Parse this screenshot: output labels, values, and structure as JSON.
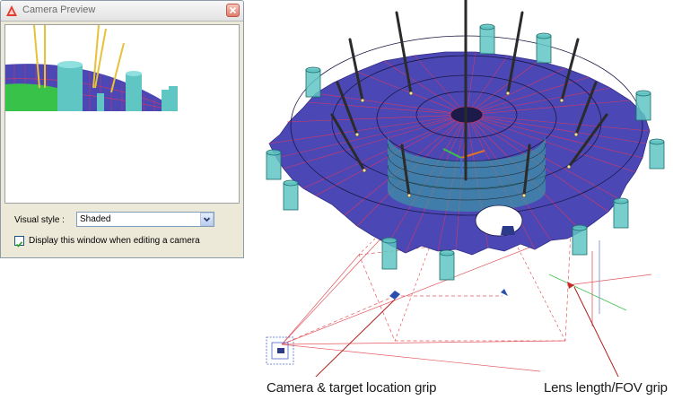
{
  "dialog": {
    "title": "Camera Preview",
    "visual_style_label": "Visual style :",
    "visual_style_value": "Shaded",
    "display_checkbox_label": "Display this window when editing a camera",
    "display_checkbox_checked": true
  },
  "callouts": {
    "camera_target_grip": "Camera & target location grip",
    "lens_fov_grip": "Lens length/FOV grip"
  },
  "colors": {
    "roof_fill": "#4b47b5",
    "roof_lines": "#e0375e",
    "mast_fill": "#333333",
    "cylinder_fill": "#5fc6c4",
    "camera_lines": "#e4585f",
    "callout_line": "#b0201b",
    "ground_green": "#39c24a"
  },
  "icons": [
    "app-icon",
    "close-icon",
    "chevron-down-icon",
    "checkmark-icon"
  ]
}
